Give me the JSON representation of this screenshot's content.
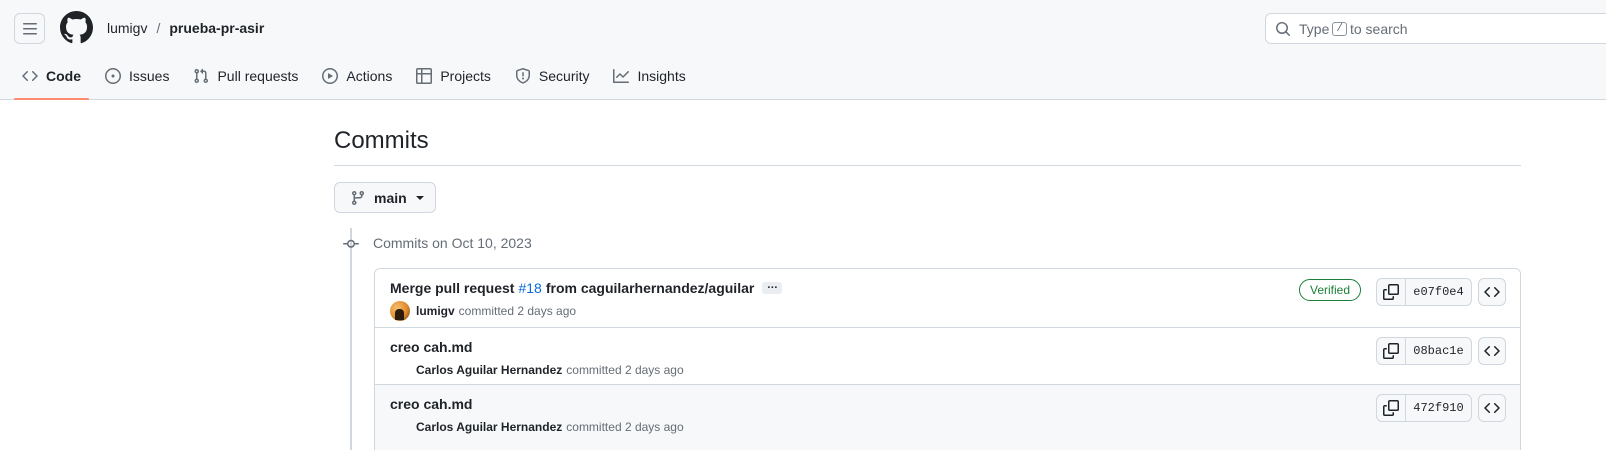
{
  "repo": {
    "owner": "lumigv",
    "separator": "/",
    "name": "prueba-pr-asir"
  },
  "search": {
    "prefix": "Type",
    "key": "/",
    "suffix": "to search"
  },
  "nav": {
    "tabs": [
      {
        "label": "Code",
        "icon": "code-icon",
        "active": true
      },
      {
        "label": "Issues",
        "icon": "issue-opened-icon"
      },
      {
        "label": "Pull requests",
        "icon": "git-pull-request-icon"
      },
      {
        "label": "Actions",
        "icon": "play-icon"
      },
      {
        "label": "Projects",
        "icon": "table-icon"
      },
      {
        "label": "Security",
        "icon": "shield-icon"
      },
      {
        "label": "Insights",
        "icon": "graph-icon"
      }
    ]
  },
  "page": {
    "title": "Commits"
  },
  "branch": {
    "name": "main"
  },
  "commit_group": {
    "heading": "Commits on Oct 10, 2023",
    "commits": [
      {
        "message_prefix": "Merge pull request",
        "pr_link": "#18",
        "message_suffix": "from caguilarhernandez/aguilar",
        "ellipsis": "…",
        "author": "lumigv",
        "action": "committed 2 days ago",
        "verified": "Verified",
        "sha": "e07f0e4"
      },
      {
        "message": "creo cah.md",
        "author": "Carlos Aguilar Hernandez",
        "action": "committed 2 days ago",
        "sha": "08bac1e"
      },
      {
        "message": "creo cah.md",
        "author": "Carlos Aguilar Hernandez",
        "action": "committed 2 days ago",
        "sha": "472f910"
      }
    ]
  },
  "colors": {
    "accent": "#fd8c73",
    "link": "#0969da",
    "verified": "#1a7f37",
    "border": "#d0d7de",
    "muted": "#656d76"
  }
}
